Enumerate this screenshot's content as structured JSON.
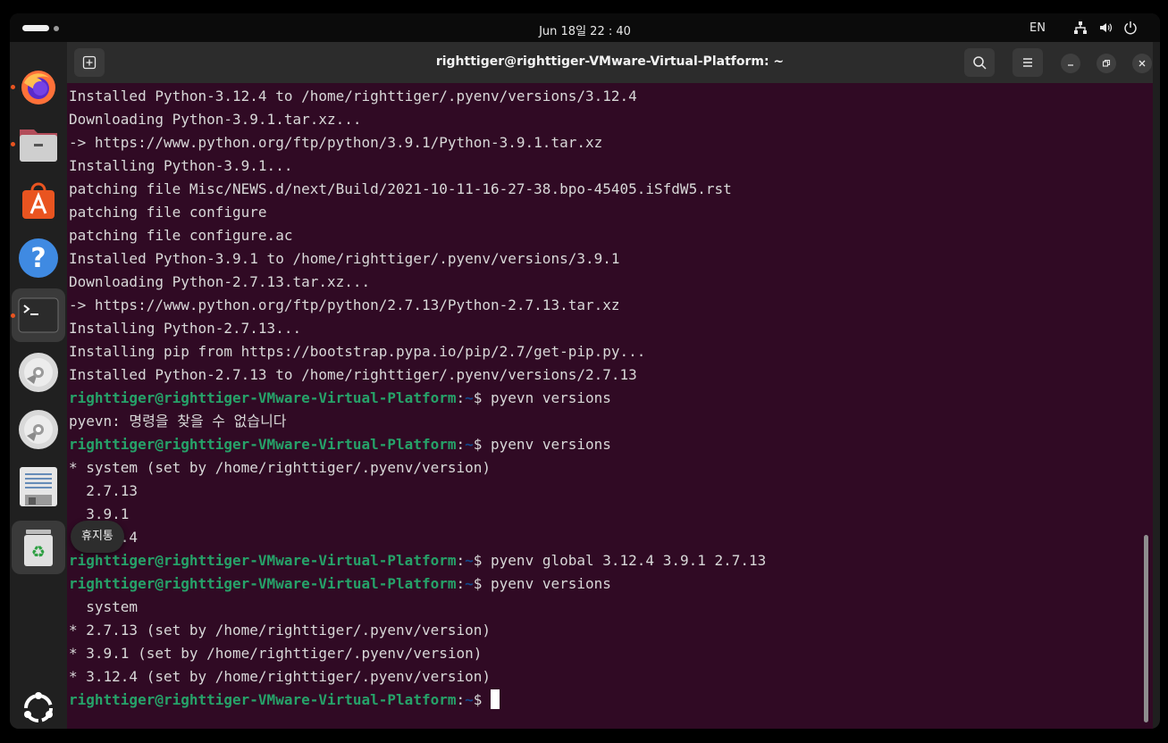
{
  "topbar": {
    "clock": "Jun 18일  22 : 40",
    "lang": "EN",
    "icons": [
      "network-icon",
      "volume-icon",
      "power-icon"
    ]
  },
  "dock": {
    "items": [
      {
        "name": "firefox",
        "running": true
      },
      {
        "name": "files",
        "running": true
      },
      {
        "name": "app-center",
        "running": false
      },
      {
        "name": "help",
        "running": false
      },
      {
        "name": "terminal",
        "running": true,
        "active": true
      },
      {
        "name": "cd-drive-1",
        "running": false
      },
      {
        "name": "cd-drive-2",
        "running": false
      },
      {
        "name": "text-editor",
        "running": false
      },
      {
        "name": "trash",
        "running": false,
        "active": true
      }
    ],
    "tooltip": "휴지통"
  },
  "window": {
    "title": "righttiger@righttiger-VMware-Virtual-Platform: ~",
    "colors": {
      "background": "#300a24",
      "user": "#26a269",
      "path": "#12488b"
    }
  },
  "prompt": {
    "user": "righttiger@righttiger-VMware-Virtual-Platform",
    "sep": ":",
    "path": "~",
    "symbol": "$ "
  },
  "terminal": {
    "lines": [
      {
        "text": "Installed Python-3.12.4 to /home/righttiger/.pyenv/versions/3.12.4"
      },
      {
        "text": "Downloading Python-3.9.1.tar.xz..."
      },
      {
        "text": "-> https://www.python.org/ftp/python/3.9.1/Python-3.9.1.tar.xz"
      },
      {
        "text": "Installing Python-3.9.1..."
      },
      {
        "text": "patching file Misc/NEWS.d/next/Build/2021-10-11-16-27-38.bpo-45405.iSfdW5.rst"
      },
      {
        "text": "patching file configure"
      },
      {
        "text": "patching file configure.ac"
      },
      {
        "text": "Installed Python-3.9.1 to /home/righttiger/.pyenv/versions/3.9.1"
      },
      {
        "text": "Downloading Python-2.7.13.tar.xz..."
      },
      {
        "text": "-> https://www.python.org/ftp/python/2.7.13/Python-2.7.13.tar.xz"
      },
      {
        "text": "Installing Python-2.7.13..."
      },
      {
        "text": "Installing pip from https://bootstrap.pypa.io/pip/2.7/get-pip.py..."
      },
      {
        "text": "Installed Python-2.7.13 to /home/righttiger/.pyenv/versions/2.7.13"
      },
      {
        "prompt": true,
        "text": "pyevn versions"
      },
      {
        "text": "pyevn: 명령을 찾을 수 없습니다"
      },
      {
        "prompt": true,
        "text": "pyenv versions"
      },
      {
        "text": "* system (set by /home/righttiger/.pyenv/version)"
      },
      {
        "text": "  2.7.13"
      },
      {
        "text": "  3.9.1"
      },
      {
        "text": "  3.12.4"
      },
      {
        "prompt": true,
        "text": "pyenv global 3.12.4 3.9.1 2.7.13"
      },
      {
        "prompt": true,
        "text": "pyenv versions"
      },
      {
        "text": "  system"
      },
      {
        "text": "* 2.7.13 (set by /home/righttiger/.pyenv/version)"
      },
      {
        "text": "* 3.9.1 (set by /home/righttiger/.pyenv/version)"
      },
      {
        "text": "* 3.12.4 (set by /home/righttiger/.pyenv/version)"
      },
      {
        "prompt": true,
        "text": "",
        "cursor": true
      }
    ]
  }
}
